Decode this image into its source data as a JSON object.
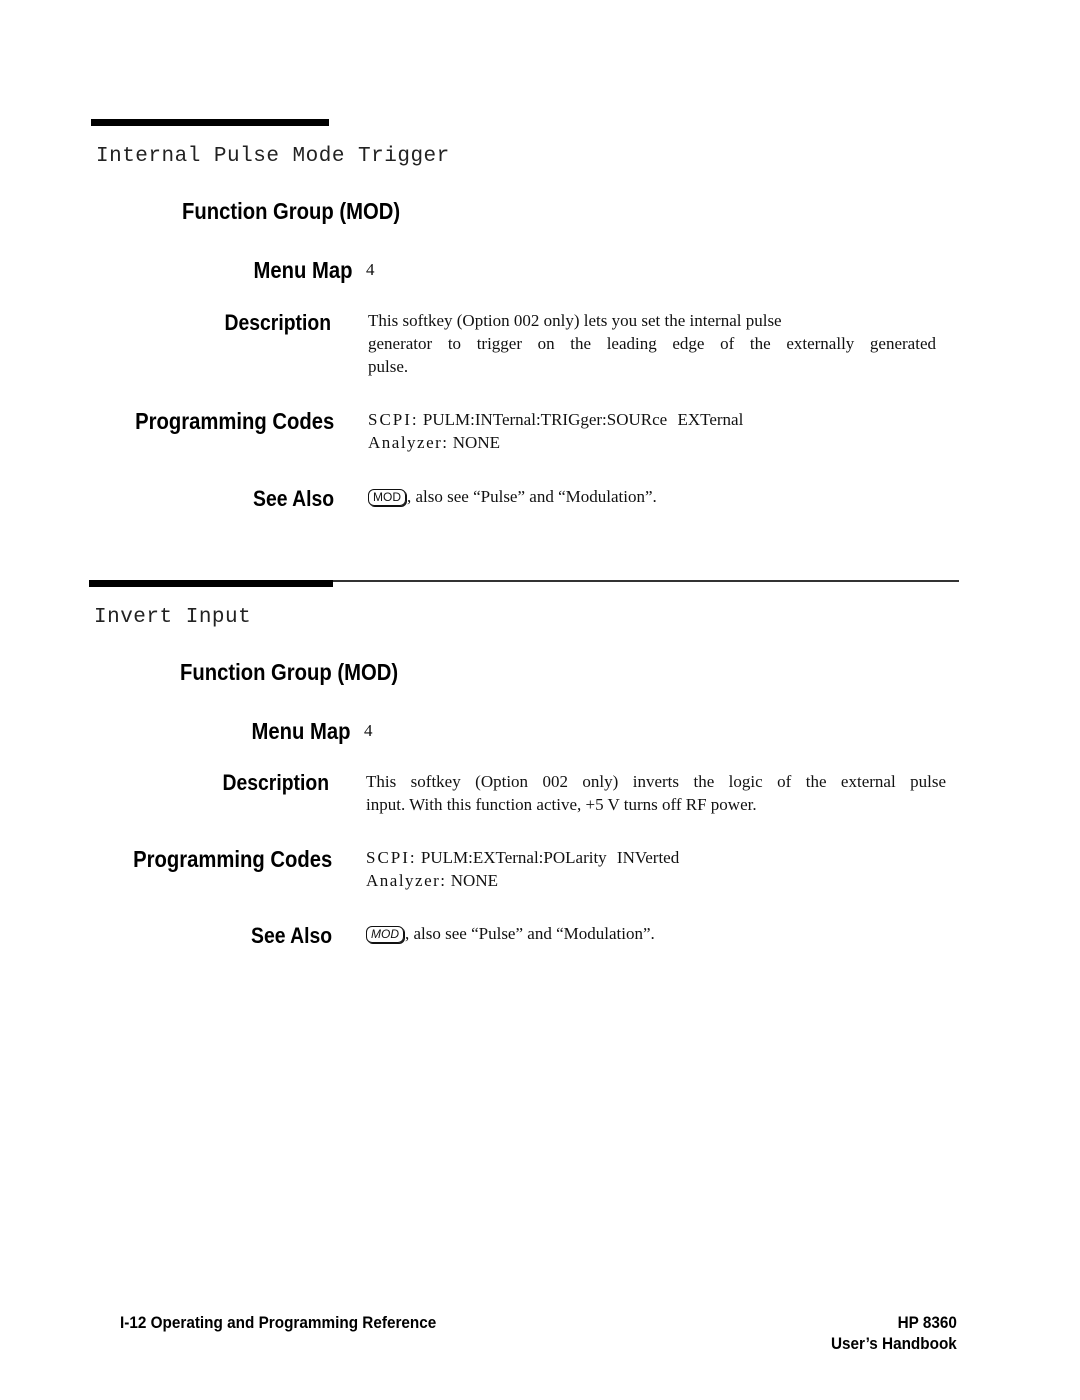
{
  "sections": [
    {
      "title": "Internal Pulse Mode Trigger",
      "function_group_label": "Function Group (MOD)",
      "menu_map_label": "Menu Map",
      "menu_map_value": "4",
      "description_label": "Description",
      "description_lines": [
        "This softkey (Option 002 only) lets you set the internal pulse",
        "generator to trigger on the leading edge of the externally generated",
        "pulse."
      ],
      "programming_codes_label": "Programming Codes",
      "scpi_prefix": "SCPI:",
      "scpi_command": "PULM:INTernal:TRIGger:SOURce",
      "scpi_argument": "EXTernal",
      "analyzer_prefix": "Analyzer:",
      "analyzer_value": "NONE",
      "see_also_label": "See Also",
      "see_also_key": "MOD",
      "see_also_text": ", also see “Pulse” and “Modulation”."
    },
    {
      "title": "Invert Input",
      "function_group_label": "Function Group (MOD)",
      "menu_map_label": "Menu Map",
      "menu_map_value": "4",
      "description_label": "Description",
      "description_lines": [
        "This softkey (Option 002 only) inverts the logic of the external pulse",
        "input. With this function active, +5 V turns off RF power."
      ],
      "programming_codes_label": "Programming Codes",
      "scpi_prefix": "SCPI:",
      "scpi_command": "PULM:EXTernal:POLarity",
      "scpi_argument": "INVerted",
      "analyzer_prefix": "Analyzer:",
      "analyzer_value": "NONE",
      "see_also_label": "See Also",
      "see_also_key": "MOD",
      "see_also_text": ", also see “Pulse” and “Modulation”."
    }
  ],
  "footer": {
    "page_ref": "I-12 Operating and Programming Reference",
    "product": "HP 8360",
    "handbook": "User’s Handbook"
  }
}
